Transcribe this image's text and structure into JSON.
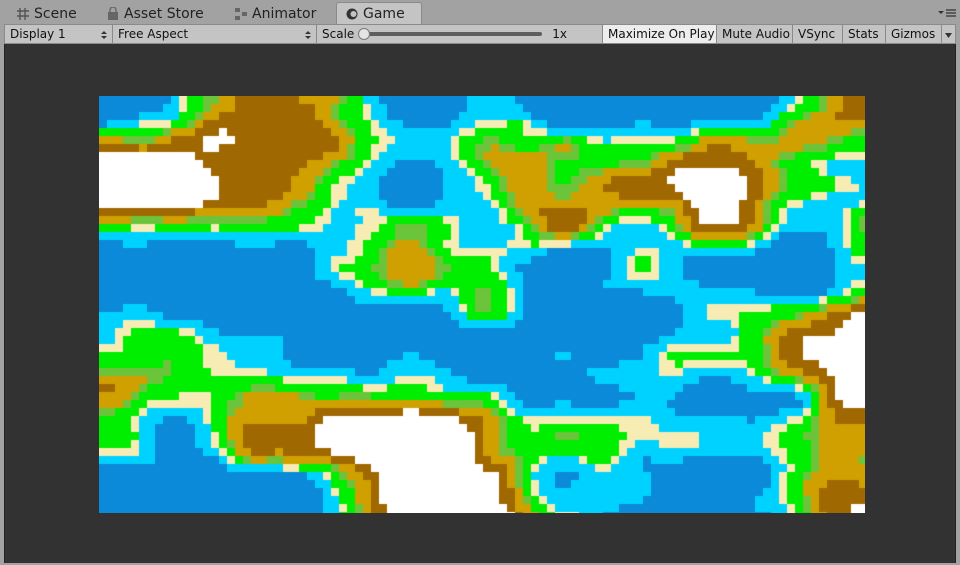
{
  "tabs": [
    {
      "label": "Scene",
      "icon": "scene-grid-icon",
      "active": false
    },
    {
      "label": "Asset Store",
      "icon": "asset-store-icon",
      "active": false
    },
    {
      "label": "Animator",
      "icon": "animator-icon",
      "active": false
    },
    {
      "label": "Game",
      "icon": "game-icon",
      "active": true
    }
  ],
  "toolbar": {
    "display_select": "Display 1",
    "aspect_select": "Free Aspect",
    "scale_label": "Scale",
    "scale_value": "1x",
    "scale_fraction": 0.0,
    "maximize_on_play": "Maximize On Play",
    "mute_audio": "Mute Audio",
    "vsync": "VSync",
    "stats": "Stats",
    "gizmos": "Gizmos"
  },
  "colors": {
    "deep_water": "#0a8ad8",
    "shallow_water": "#00d2ff",
    "sand": "#f7ecb4",
    "grass": "#00ee00",
    "dark_grass": "#6cc43a",
    "hills": "#d0a000",
    "mountain": "#a06800",
    "snow": "#ffffff",
    "viewport_bg": "#323232"
  }
}
